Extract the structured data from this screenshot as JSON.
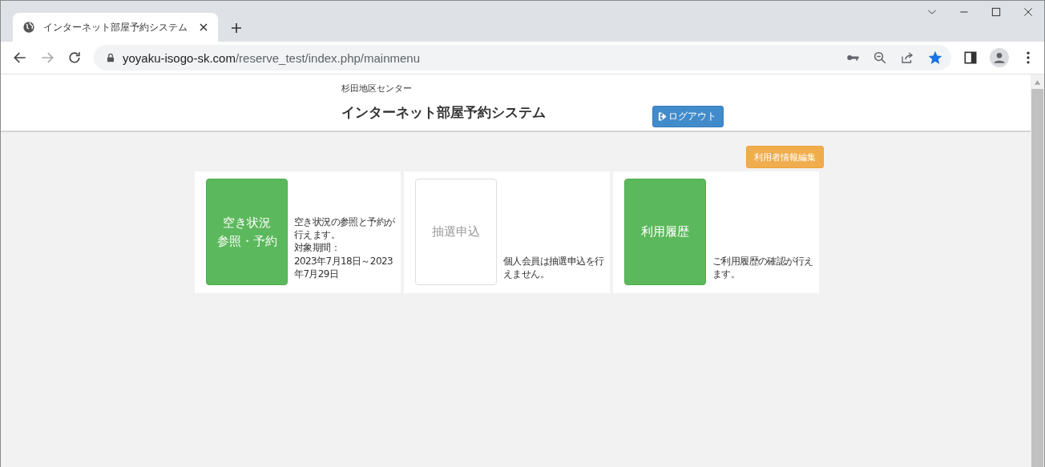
{
  "browser": {
    "tab": {
      "title": "インターネット部屋予約システム"
    },
    "url": {
      "host": "yoyaku-isogo-sk.com",
      "path": "/reserve_test/index.php/mainmenu"
    },
    "bookmarked": true
  },
  "header": {
    "center_name": "杉田地区センター",
    "title": "インターネット部屋予約システム",
    "logout_button": "ログアウト"
  },
  "profile_button": "利用者情報編集",
  "menu_cards": [
    {
      "label": [
        "空き状況",
        "参照・予約"
      ],
      "disabled": false,
      "description": [
        "空き状況の参照と予約が行えます。",
        "対象期間：",
        "2023年7月18日～2023年7月29日"
      ]
    },
    {
      "label": [
        "抽選申込"
      ],
      "disabled": true,
      "description": [
        "個人会員は抽選申込を行えません。"
      ]
    },
    {
      "label": [
        "利用履歴"
      ],
      "disabled": false,
      "description": [
        "ご利用履歴の確認が行えます。"
      ]
    }
  ]
}
